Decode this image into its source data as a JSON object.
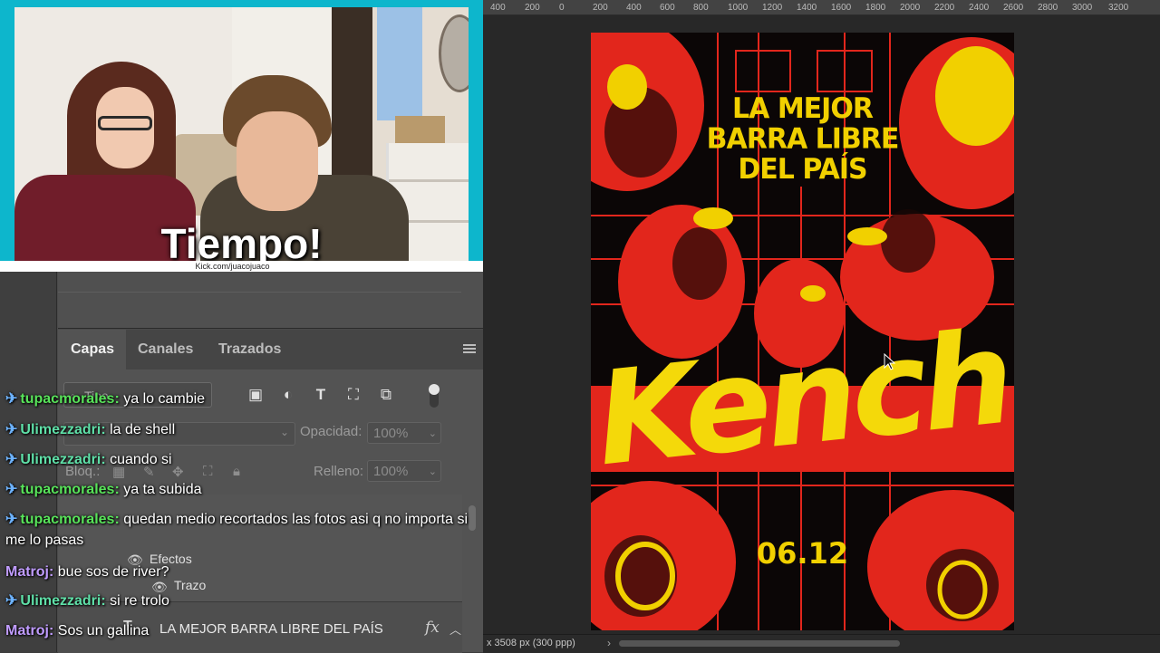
{
  "webcam": {
    "caption": "Tiempo!",
    "url": "Kick.com/juacojuaco"
  },
  "ruler": {
    "ticks": [
      "400",
      "200",
      "0",
      "200",
      "400",
      "600",
      "800",
      "1000",
      "1200",
      "1400",
      "1600",
      "1800",
      "2000",
      "2200",
      "2400",
      "2600",
      "2800",
      "3000",
      "3200"
    ]
  },
  "layers_panel": {
    "tabs": [
      {
        "label": "Capas",
        "active": true
      },
      {
        "label": "Canales",
        "active": false
      },
      {
        "label": "Trazados",
        "active": false
      }
    ],
    "filter_placeholder": "Tipo",
    "opacity_label": "Opacidad:",
    "opacity_value": "100%",
    "lock_label": "Bloq.:",
    "fill_label": "Relleno:",
    "fill_value": "100%",
    "effects_label": "Efectos",
    "stroke_label": "Trazo",
    "text_layer_name": "LA MEJOR BARRA LIBRE DEL PAÍS",
    "fx_badge": "fx"
  },
  "chat": [
    {
      "user": "tupacmorales",
      "color": "#58e35a",
      "badge": true,
      "text": "ya lo cambie"
    },
    {
      "user": "Ulimezzadri",
      "color": "#5fe0a8",
      "badge": true,
      "text": "la de shell"
    },
    {
      "user": "Ulimezzadri",
      "color": "#5fe0a8",
      "badge": true,
      "text": "cuando si"
    },
    {
      "user": "tupacmorales",
      "color": "#58e35a",
      "badge": true,
      "text": "ya ta subida"
    },
    {
      "user": "tupacmorales",
      "color": "#58e35a",
      "badge": true,
      "text": "quedan medio recortados las fotos asi q no importa si me lo pasas"
    },
    {
      "user": "Matroj",
      "color": "#c09cff",
      "badge": false,
      "text": "bue sos de river?"
    },
    {
      "user": "Ulimezzadri",
      "color": "#5fe0a8",
      "badge": true,
      "text": "si re trolo"
    },
    {
      "user": "Matroj",
      "color": "#c09cff",
      "badge": false,
      "text": "Sos un gallina"
    }
  ],
  "poster": {
    "headline_line1": "LA MEJOR",
    "headline_line2": "BARRA LIBRE",
    "headline_line3": "DEL PAÍS",
    "brand": "Kench",
    "date": "06.12",
    "colors": {
      "red": "#e2261c",
      "yellow": "#f1d000",
      "black": "#0b0606"
    }
  },
  "status_bar": {
    "doc_info": "x 3508 px (300 ppp)"
  }
}
